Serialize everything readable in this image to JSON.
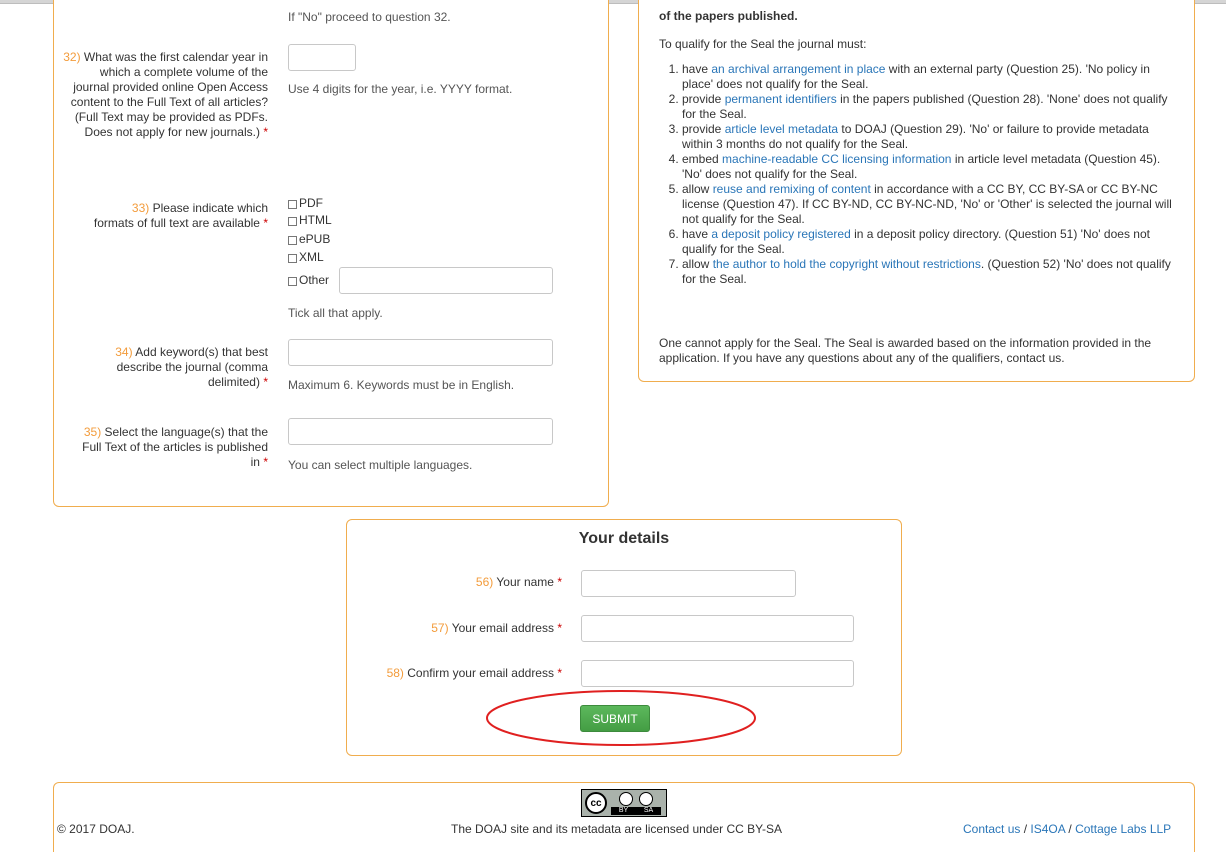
{
  "left_form": {
    "q31_tail": "If \"No\" proceed to question 32.",
    "q32": {
      "number": "32)",
      "label": "What was the first calendar year in which a complete volume of the journal provided online Open Access content to the Full Text of all articles? (Full Text may be provided as PDFs. Does not apply for new journals.)",
      "required_mark": "*",
      "hint": "Use 4 digits for the year, i.e. YYYY format.",
      "value": ""
    },
    "q33": {
      "number": "33)",
      "label": "Please indicate which formats of full text are available",
      "required_mark": "*",
      "options": [
        "PDF",
        "HTML",
        "ePUB",
        "XML",
        "Other"
      ],
      "hint": "Tick all that apply."
    },
    "q34": {
      "number": "34)",
      "label": "Add keyword(s) that best describe the journal (comma delimited)",
      "required_mark": "*",
      "hint": "Maximum 6. Keywords must be in English.",
      "value": ""
    },
    "q35": {
      "number": "35)",
      "label": "Select the language(s) that the Full Text of the articles is published in",
      "required_mark": "*",
      "hint": "You can select multiple languages.",
      "value": ""
    }
  },
  "seal_box": {
    "heading_tail": "of the papers published.",
    "intro": "To qualify for the Seal the journal must:",
    "items": [
      {
        "pre": "have ",
        "link": "an archival arrangement in place",
        "post": " with an external party (Question 25). 'No policy in place' does not qualify for the Seal."
      },
      {
        "pre": "provide ",
        "link": "permanent identifiers",
        "post": " in the papers published (Question 28). 'None' does not qualify for the Seal."
      },
      {
        "pre": "provide ",
        "link": "article level metadata",
        "post": " to DOAJ (Question 29). 'No' or failure to provide metadata within 3 months do not qualify for the Seal."
      },
      {
        "pre": "embed ",
        "link": "machine-readable CC licensing information",
        "post": " in article level metadata (Question 45). 'No' does not qualify for the Seal."
      },
      {
        "pre": "allow ",
        "link": "reuse and remixing of content",
        "post": " in accordance with a CC BY, CC BY-SA or CC BY-NC license (Question 47). If CC BY-ND, CC BY-NC-ND, 'No' or 'Other' is selected the journal will not qualify for the Seal."
      },
      {
        "pre": "have ",
        "link": "a deposit policy registered",
        "post": " in a deposit policy directory. (Question 51) 'No' does not qualify for the Seal."
      },
      {
        "pre": "allow ",
        "link": "the author to hold the copyright without restrictions",
        "post": ". (Question 52) 'No' does not qualify for the Seal."
      }
    ],
    "closing": "One cannot apply for the Seal. The Seal is awarded based on the information provided in the application. If you have any questions about any of the qualifiers, contact us."
  },
  "details": {
    "title": "Your details",
    "name": {
      "number": "56)",
      "label": "Your name",
      "required_mark": "*",
      "value": ""
    },
    "email": {
      "number": "57)",
      "label": "Your email address",
      "required_mark": "*",
      "value": ""
    },
    "confirm": {
      "number": "58)",
      "label": "Confirm your email address",
      "required_mark": "*",
      "value": ""
    },
    "submit_label": "SUBMIT",
    "highlight_color": "#e02020"
  },
  "footer": {
    "copyright": "© 2017 DOAJ.",
    "license_text": "The DOAJ site and its metadata are licensed under CC BY-SA",
    "cc_badge": {
      "cc": "cc",
      "by": "BY",
      "sa": "SA"
    },
    "links": [
      "Contact us",
      "IS4OA",
      "Cottage Labs LLP"
    ],
    "link_sep": " / "
  },
  "colors": {
    "accent_border": "#f0ad4e",
    "number": "#f39c3c",
    "required": "#cc0000",
    "link": "#2a76b8",
    "button": "#5cb85c"
  }
}
